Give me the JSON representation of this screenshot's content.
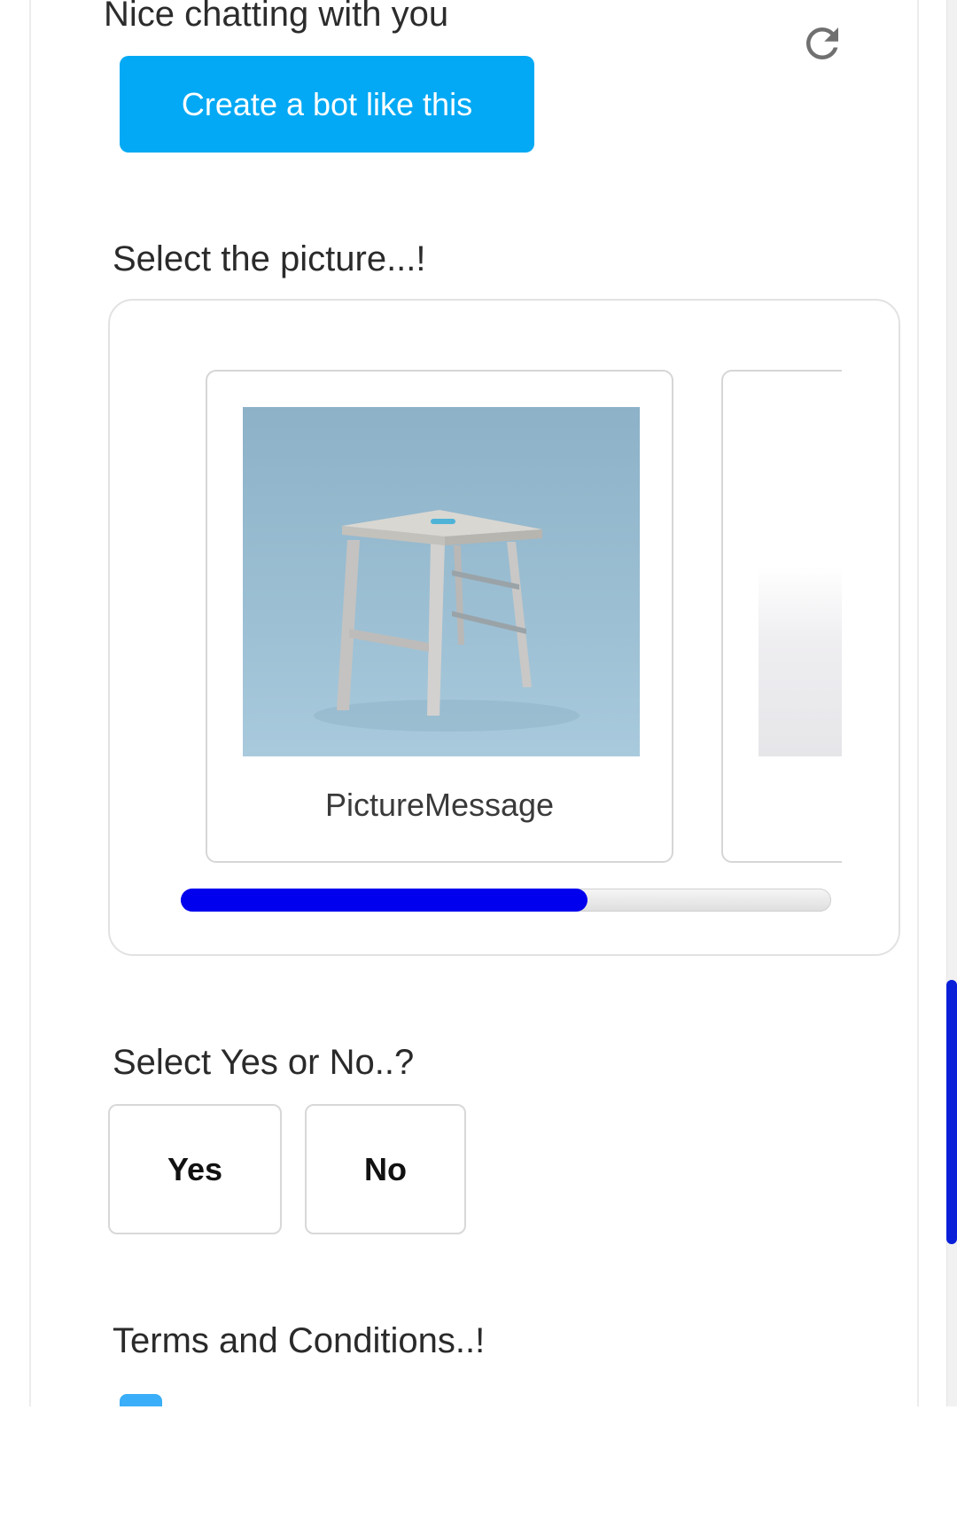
{
  "header": {
    "message": "Nice chatting with you",
    "refresh_icon": "refresh-icon",
    "create_button_label": "Create a bot like this",
    "accent_color": "#03a9f4"
  },
  "picture_section": {
    "label": "Select the picture...!",
    "cards": [
      {
        "label": "PictureMessage",
        "image": "wooden-stool-photo"
      },
      {
        "label": "",
        "image": "partial-card-image"
      }
    ],
    "scroll_progress": 0.625,
    "scroll_color": "#0000ee"
  },
  "yes_no_section": {
    "label": "Select Yes or No..?",
    "options": [
      "Yes",
      "No"
    ]
  },
  "terms_section": {
    "label": "Terms and Conditions..!"
  }
}
